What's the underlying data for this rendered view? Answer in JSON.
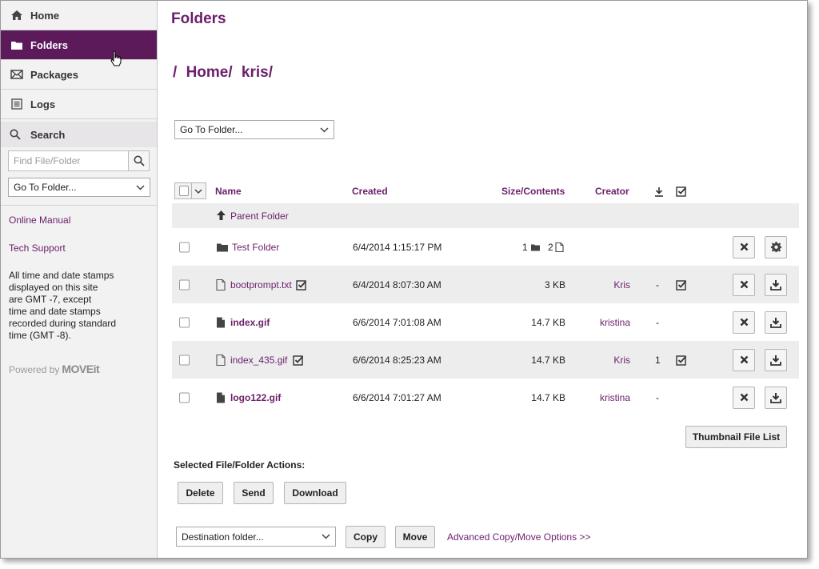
{
  "sidebar": {
    "nav": [
      {
        "label": "Home",
        "icon": "home-icon"
      },
      {
        "label": "Folders",
        "icon": "folder-icon"
      },
      {
        "label": "Packages",
        "icon": "envelope-icon"
      },
      {
        "label": "Logs",
        "icon": "log-list-icon"
      }
    ],
    "search": {
      "label": "Search",
      "placeholder": "Find File/Folder",
      "goto_value": "Go To Folder..."
    },
    "links": {
      "manual": "Online Manual",
      "support": "Tech Support"
    },
    "time_note": [
      "All time and date stamps",
      "displayed on this site",
      "are GMT -7, except",
      "time and date stamps",
      "recorded during standard",
      "time (GMT -8)."
    ],
    "powered_by": "Powered by",
    "brand": "MOVEit"
  },
  "main": {
    "title": "Folders",
    "breadcrumb": [
      "/",
      "Home/",
      "kris/"
    ],
    "goto_value": "Go To Folder...",
    "columns": {
      "name": "Name",
      "created": "Created",
      "size": "Size/Contents",
      "creator": "Creator"
    },
    "parent_folder": "Parent Folder",
    "rows": [
      {
        "name": "Test Folder",
        "type": "folder",
        "created": "6/4/2014 1:15:17 PM",
        "folders": "1",
        "files": "2",
        "size": "",
        "creator": "",
        "downloads": "",
        "verified": false,
        "action": "settings"
      },
      {
        "name": "bootprompt.txt",
        "type": "file",
        "bold": false,
        "created": "6/4/2014 8:07:30 AM",
        "size": "3 KB",
        "creator": "Kris",
        "downloads": "-",
        "verified": true,
        "action": "download"
      },
      {
        "name": "index.gif",
        "type": "file",
        "bold": true,
        "created": "6/6/2014 7:01:08 AM",
        "size": "14.7 KB",
        "creator": "kristina",
        "downloads": "-",
        "verified": false,
        "action": "download"
      },
      {
        "name": "index_435.gif",
        "type": "file",
        "bold": false,
        "created": "6/6/2014 8:25:23 AM",
        "size": "14.7 KB",
        "creator": "Kris",
        "downloads": "1",
        "verified": true,
        "action": "download"
      },
      {
        "name": "logo122.gif",
        "type": "file",
        "bold": true,
        "created": "6/6/2014 7:01:27 AM",
        "size": "14.7 KB",
        "creator": "kristina",
        "downloads": "-",
        "verified": false,
        "action": "download"
      }
    ],
    "thumbnail_button": "Thumbnail File List",
    "actions_label": "Selected File/Folder Actions:",
    "actions": {
      "delete": "Delete",
      "send": "Send",
      "download": "Download"
    },
    "destination_value": "Destination folder...",
    "copy": "Copy",
    "move": "Move",
    "advanced_link": "Advanced Copy/Move Options >>"
  },
  "colors": {
    "brand_purple": "#5c1a5b",
    "link_purple": "#6b1f6b"
  }
}
